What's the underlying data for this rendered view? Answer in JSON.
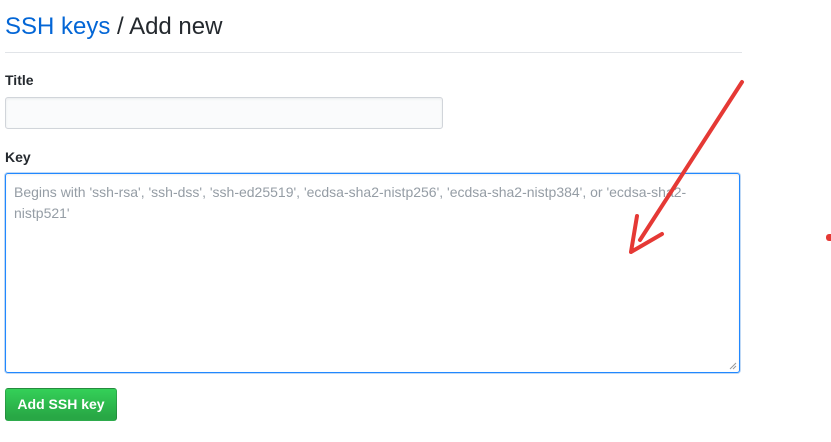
{
  "header": {
    "breadcrumb_link": "SSH keys",
    "separator": "/",
    "current": "Add new"
  },
  "form": {
    "title_label": "Title",
    "title_value": "",
    "key_label": "Key",
    "key_value": "",
    "key_placeholder": "Begins with 'ssh-rsa', 'ssh-dss', 'ssh-ed25519', 'ecdsa-sha2-nistp256', 'ecdsa-sha2-nistp384', or 'ecdsa-sha2-nistp521'",
    "submit_label": "Add SSH key"
  },
  "colors": {
    "link": "#0366d6",
    "button_green": "#28a745",
    "focus_border": "#2188ff",
    "annotation_arrow": "#e53935"
  },
  "annotations": {
    "arrow_icon": "red-arrow-icon"
  }
}
